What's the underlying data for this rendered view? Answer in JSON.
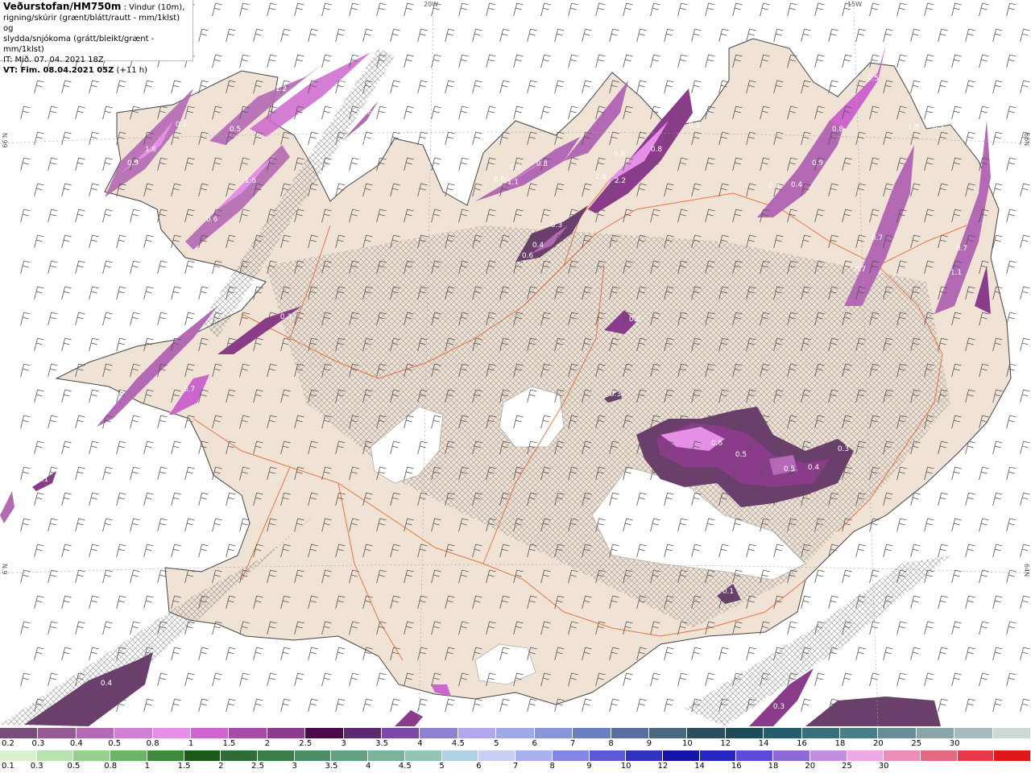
{
  "info": {
    "model": "Veðurstofan/HM750m",
    "line1": " : Vindur (10m),",
    "line2": "rigning/skúrir (grænt/blátt/rautt - mm/1klst) og",
    "line3": "slydda/snjókoma (grátt/bleikt/grænt - mm/1klst)",
    "it": "IT: Mið. 07. 04. 2021 18Z",
    "vt": "VT: Fim. 08.04.2021 05Z",
    "vt_offset": " (+11 h)"
  },
  "grid_labels": {
    "top_left": "20W",
    "top_right": "15W",
    "left_upper": "N.99",
    "left_lower": "N.9",
    "right_upper": "66N",
    "right_lower": "64N"
  },
  "precip_labels": [
    "0.2",
    "0.9",
    "1.6",
    "0.5",
    "1.2",
    "0.6",
    "0.9",
    "0.6",
    "1.6",
    "0.3",
    "0.5",
    "0.6",
    "0.5",
    "0.6",
    "0.8",
    "1.1",
    "0.8",
    "2.8",
    "2.2",
    "0.8",
    "0.5",
    "0.3",
    "0.4",
    "0.6",
    "0.5",
    "0.8",
    "0.4",
    "0.9",
    "0.8",
    "0.7",
    "0.7",
    "1.8",
    "0.7",
    "1.1",
    "0.3",
    "0.2",
    "0.3",
    "0.9",
    "0.7",
    "0.1",
    "0.6",
    "0.5",
    "0.5",
    "0.4",
    "0.3",
    "0.1",
    "0.4",
    "0.3"
  ],
  "legend_snow": {
    "colors": [
      "#7a4e7a",
      "#955b95",
      "#b369b3",
      "#d080d0",
      "#e68fe6",
      "#cc66cc",
      "#a64ca6",
      "#8a3c8a",
      "#4a0a4a",
      "#5d2a6e",
      "#7a4aa6",
      "#9080d0",
      "#b0a8ec",
      "#a0a8e6",
      "#8896d6",
      "#6a7fbe",
      "#5a6e9e",
      "#4a6880",
      "#2a4e5e",
      "#1e4a5a",
      "#275c6a",
      "#3a6e7a",
      "#4a7e88",
      "#6a8e96",
      "#8aa6aa",
      "#a6bcbe",
      "#ccd8d8"
    ],
    "labels": [
      "0.2",
      "0.3",
      "0.4",
      "0.5",
      "0.8",
      "1",
      "1.5",
      "2",
      "2.5",
      "3",
      "3.5",
      "4",
      "4.5",
      "5",
      "6",
      "7",
      "8",
      "9",
      "10",
      "12",
      "14",
      "16",
      "18",
      "20",
      "25",
      "30"
    ]
  },
  "legend_rain": {
    "colors": [
      "#d8f2d0",
      "#b8e2b0",
      "#96cf8e",
      "#6eb466",
      "#3c8a3a",
      "#1c5a1c",
      "#2e6e36",
      "#3c7e4a",
      "#4e8e66",
      "#62a07e",
      "#7ab29a",
      "#94c4b4",
      "#b0d2e2",
      "#c8cef4",
      "#aab0ee",
      "#8486e6",
      "#5a5ad8",
      "#3232c0",
      "#1414a8",
      "#2626c0",
      "#5d4ad6",
      "#8e6ad6",
      "#c48ee0",
      "#f0a8e6",
      "#ec8cb8",
      "#e4687e",
      "#e8384a",
      "#e01818"
    ],
    "labels": [
      "0.1",
      "0.3",
      "0.5",
      "0.8",
      "1",
      "1.5",
      "2",
      "2.5",
      "3",
      "3.5",
      "4",
      "4.5",
      "5",
      "6",
      "7",
      "8",
      "9",
      "10",
      "12",
      "14",
      "16",
      "18",
      "20",
      "25",
      "30"
    ]
  },
  "colors": {
    "land": "#f0e2d4",
    "sea": "#ffffff",
    "roads": "#e8612c",
    "snow_light": "#e68fe6",
    "snow_mid": "#b369b3",
    "snow_dark": "#6b3f6b"
  }
}
